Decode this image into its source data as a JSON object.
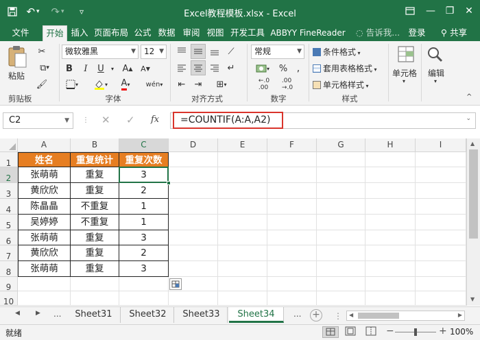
{
  "titlebar": {
    "title": "Excel教程模板.xlsx - Excel",
    "minimize": "—",
    "restore": "❐",
    "close": "✕"
  },
  "tabs": {
    "file": "文件",
    "home": "开始",
    "insert": "插入",
    "page_layout": "页面布局",
    "formulas": "公式",
    "data": "数据",
    "review": "审阅",
    "view": "视图",
    "developer": "开发工具",
    "abbyy": "ABBYY FineReader",
    "tell_me": "告诉我...",
    "signin": "登录",
    "share": "共享"
  },
  "ribbon": {
    "clipboard": {
      "paste": "粘贴",
      "label": "剪贴板"
    },
    "font": {
      "name": "微软雅黑",
      "size": "12",
      "label": "字体",
      "bold": "B",
      "italic": "I",
      "underline": "U"
    },
    "alignment": {
      "label": "对齐方式"
    },
    "number": {
      "format": "常规",
      "label": "数字",
      "percent": "%"
    },
    "styles": {
      "conditional": "条件格式",
      "table": "套用表格格式",
      "cell": "单元格样式",
      "label": "样式"
    },
    "cells": {
      "label": "单元格"
    },
    "editing": {
      "label": "编辑"
    }
  },
  "formula_bar": {
    "name_box": "C2",
    "fx": "fx",
    "formula": "=COUNTIF(A:A,A2)"
  },
  "grid": {
    "columns": [
      "A",
      "B",
      "C",
      "D",
      "E",
      "F",
      "G",
      "H",
      "I"
    ],
    "rows": [
      "1",
      "2",
      "3",
      "4",
      "5",
      "6",
      "7",
      "8",
      "9",
      "10"
    ],
    "headers": [
      "姓名",
      "重复统计",
      "重复次数"
    ],
    "data": [
      [
        "张萌萌",
        "重复",
        "3"
      ],
      [
        "黄欣欣",
        "重复",
        "2"
      ],
      [
        "陈晶晶",
        "不重复",
        "1"
      ],
      [
        "吴婷婷",
        "不重复",
        "1"
      ],
      [
        "张萌萌",
        "重复",
        "3"
      ],
      [
        "黄欣欣",
        "重复",
        "2"
      ],
      [
        "张萌萌",
        "重复",
        "3"
      ]
    ]
  },
  "sheets": {
    "ellipsis": "...",
    "tabs": [
      "Sheet31",
      "Sheet32",
      "Sheet33",
      "Sheet34"
    ],
    "active": "Sheet34"
  },
  "status": {
    "ready": "就绪",
    "zoom": "100%"
  },
  "colors": {
    "excel_green": "#217346",
    "header_fill": "#e67e22",
    "highlight_red": "#d9342b"
  }
}
